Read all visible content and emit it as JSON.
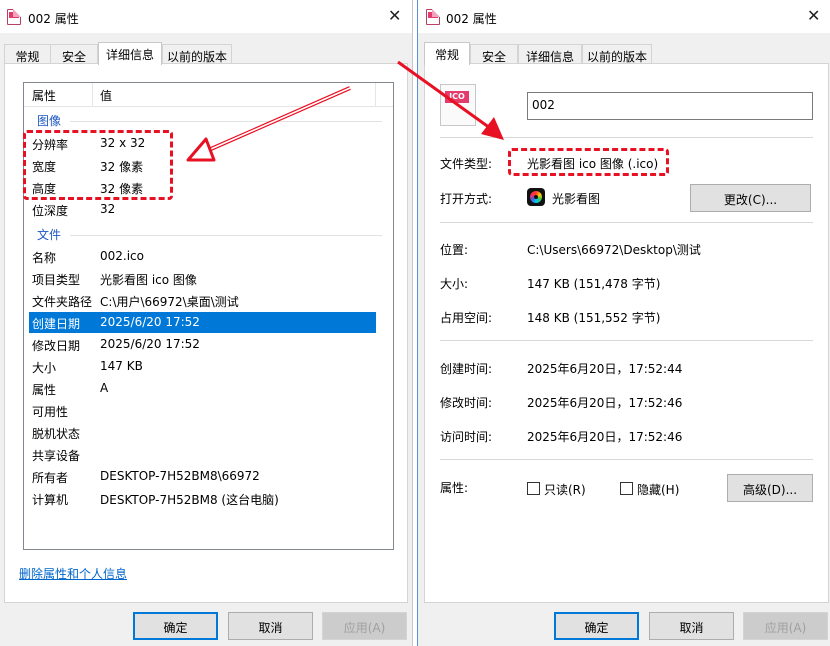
{
  "left": {
    "title": "002 属性",
    "close_glyph": "✕",
    "tabs": [
      "常规",
      "安全",
      "详细信息",
      "以前的版本"
    ],
    "columns": {
      "property": "属性",
      "value": "值"
    },
    "groups": {
      "image": "图像",
      "file": "文件"
    },
    "image_rows": [
      {
        "k": "分辨率",
        "v": "32 x 32"
      },
      {
        "k": "宽度",
        "v": "32 像素"
      },
      {
        "k": "高度",
        "v": "32 像素"
      },
      {
        "k": "位深度",
        "v": "32"
      }
    ],
    "file_rows": [
      {
        "k": "名称",
        "v": "002.ico"
      },
      {
        "k": "项目类型",
        "v": "光影看图 ico 图像"
      },
      {
        "k": "文件夹路径",
        "v": "C:\\用户\\66972\\桌面\\测试"
      },
      {
        "k": "创建日期",
        "v": "2025/6/20 17:52"
      },
      {
        "k": "修改日期",
        "v": "2025/6/20 17:52"
      },
      {
        "k": "大小",
        "v": "147 KB"
      },
      {
        "k": "属性",
        "v": "A"
      },
      {
        "k": "可用性",
        "v": ""
      },
      {
        "k": "脱机状态",
        "v": ""
      },
      {
        "k": "共享设备",
        "v": ""
      },
      {
        "k": "所有者",
        "v": "DESKTOP-7H52BM8\\66972"
      },
      {
        "k": "计算机",
        "v": "DESKTOP-7H52BM8 (这台电脑)"
      }
    ],
    "remove_link": "删除属性和个人信息",
    "buttons": {
      "ok": "确定",
      "cancel": "取消",
      "apply": "应用(A)"
    }
  },
  "right": {
    "title": "002 属性",
    "close_glyph": "✕",
    "tabs": [
      "常规",
      "安全",
      "详细信息",
      "以前的版本"
    ],
    "icon_tag": "ICO",
    "file_name": "002",
    "labels": {
      "type": "文件类型:",
      "open_with": "打开方式:",
      "location": "位置:",
      "size": "大小:",
      "size_on_disk": "占用空间:",
      "created": "创建时间:",
      "modified": "修改时间:",
      "accessed": "访问时间:",
      "attributes": "属性:"
    },
    "values": {
      "type": "光影看图 ico 图像 (.ico)",
      "open_with": "光影看图",
      "location": "C:\\Users\\66972\\Desktop\\测试",
      "size": "147 KB (151,478 字节)",
      "size_on_disk": "148 KB (151,552 字节)",
      "created": "2025年6月20日，17:52:44",
      "modified": "2025年6月20日，17:52:46",
      "accessed": "2025年6月20日，17:52:46"
    },
    "change_button": "更改(C)...",
    "readonly_label": "只读(R)",
    "readonly_checked": false,
    "hidden_label": "隐藏(H)",
    "hidden_checked": false,
    "advanced_button": "高级(D)...",
    "buttons": {
      "ok": "确定",
      "cancel": "取消",
      "apply": "应用(A)"
    }
  },
  "colors": {
    "highlight": "#e81123",
    "selection": "#0078d7",
    "group_label": "#1e57c3",
    "link": "#0066cc"
  }
}
